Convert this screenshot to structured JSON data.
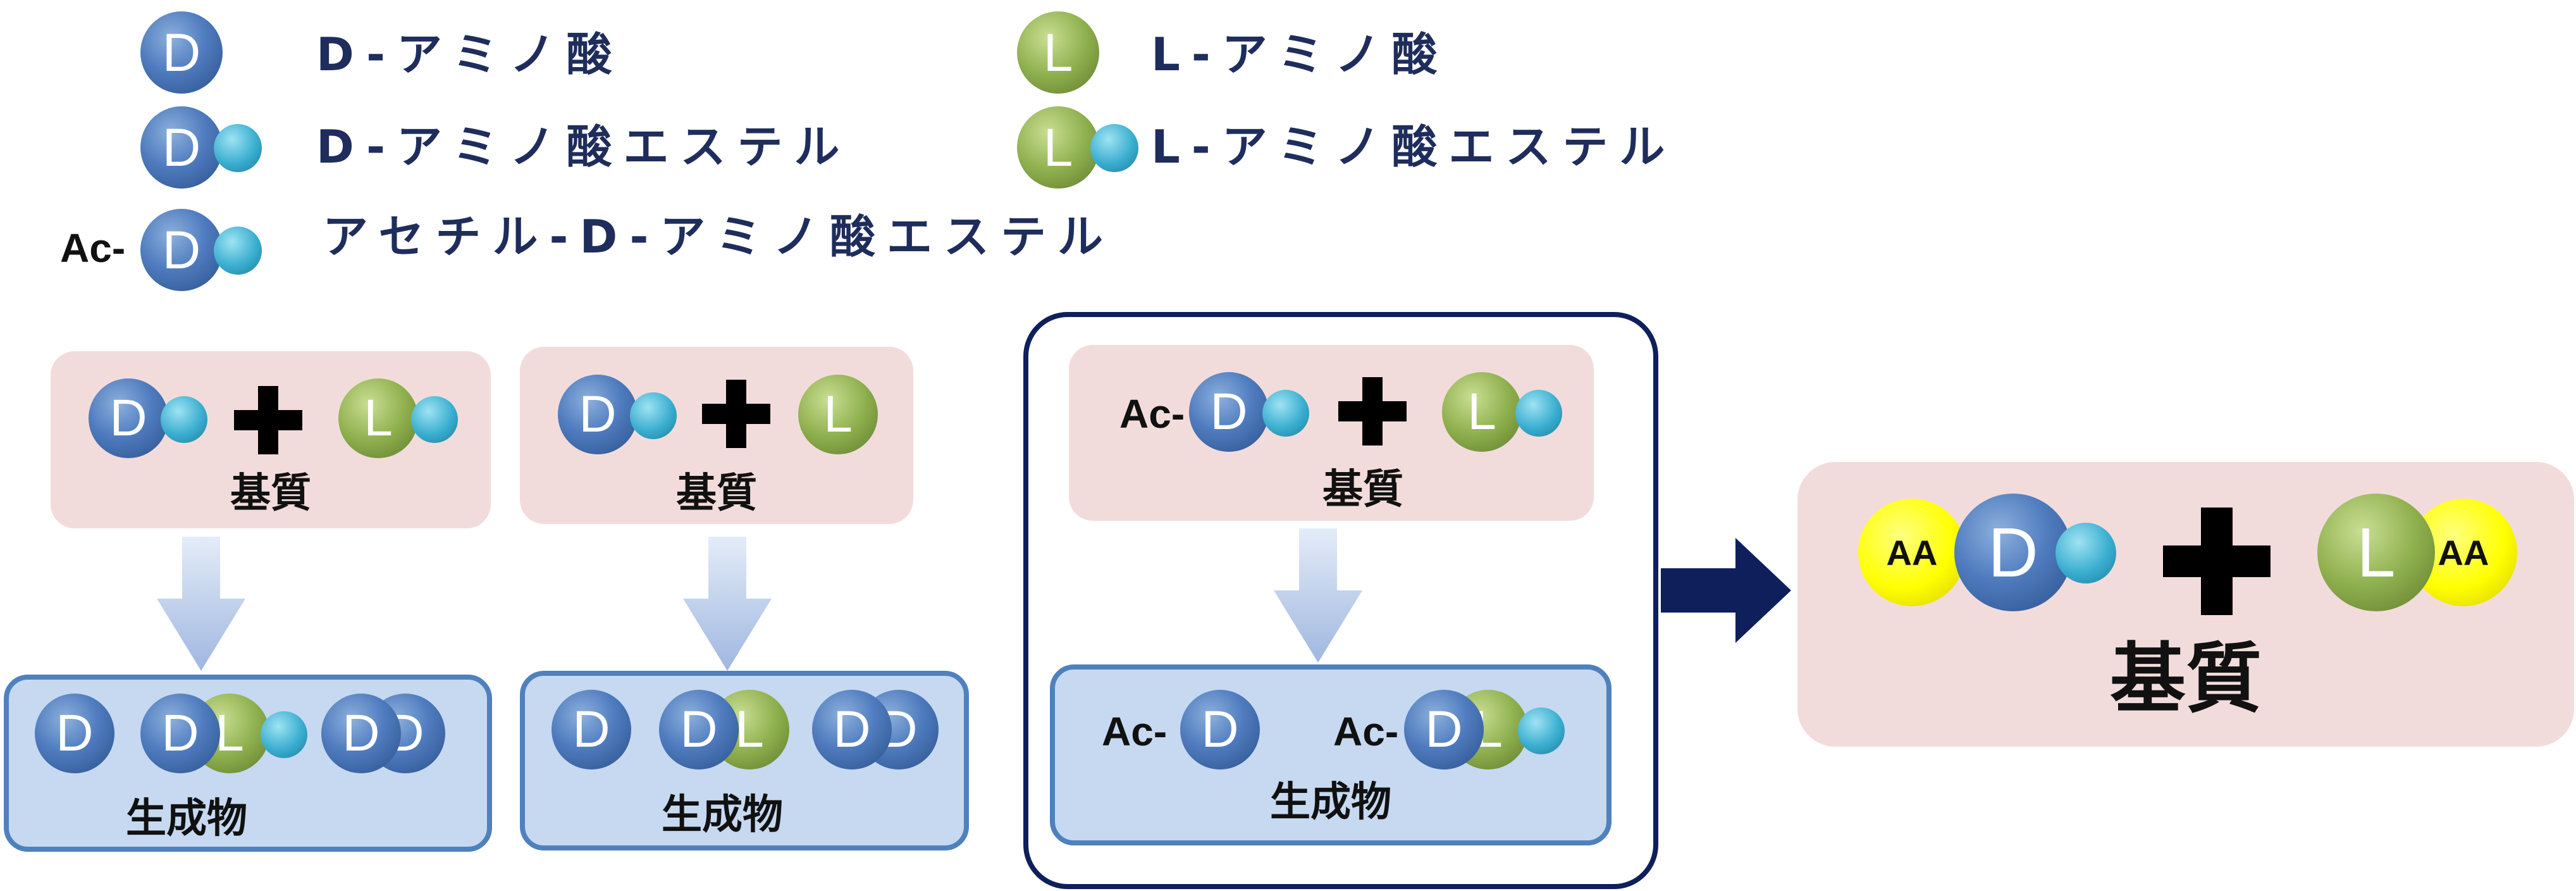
{
  "legend": {
    "d_amino_acid": "D-アミノ酸",
    "d_amino_acid_ester": "D-アミノ酸エステル",
    "acetyl_d_amino_acid_ester": "アセチル-D-アミノ酸エステル",
    "l_amino_acid": "L-アミノ酸",
    "l_amino_acid_ester": "L-アミノ酸エステル",
    "ac_prefix": "Ac-"
  },
  "symbols": {
    "d": "D",
    "l": "L",
    "aa": "AA",
    "ac": "Ac-"
  },
  "captions": {
    "substrate": "基質",
    "product": "生成物"
  },
  "colors": {
    "substrate_box": "#f2dcdb",
    "product_box": "#c6d9f1",
    "product_border": "#4f81bd",
    "frame_border": "#0f1f5c",
    "d_residue": "#4f7cbf",
    "l_residue": "#8fb04e",
    "ester_group": "#3aaed0",
    "aa_group": "#ffff00",
    "label_text": "#1f2d5c"
  }
}
